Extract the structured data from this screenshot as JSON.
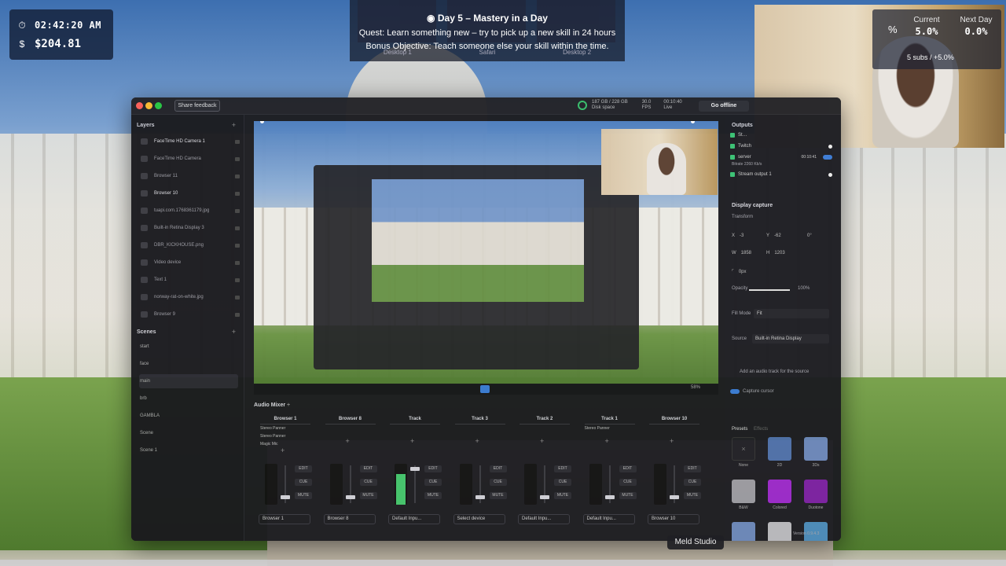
{
  "hud": {
    "time": "02:42:20 AM",
    "money": "$204.81",
    "clock_icon": "clock-icon",
    "dollar_sign": "$"
  },
  "quest": {
    "title": "Day 5 – Mastery in a Day",
    "quest_line": "Quest: Learn something new – try to pick up a new skill in 24 hours",
    "bonus_line": "Bonus Objective: Teach someone else your skill within the time.",
    "desktop_labels": [
      "Desktop 1",
      "Safari",
      "Desktop 2"
    ]
  },
  "rate": {
    "icon": "%",
    "current_label": "Current",
    "current_value": "5.0%",
    "next_label": "Next Day",
    "next_value": "0.0%",
    "subs_text": "5 subs / +5.0%"
  },
  "app": {
    "share_feedback": "Share feedback",
    "disk_space_value": "187 GB / 228 GB",
    "disk_space_label": "Disk space",
    "fps_value": "30.0",
    "fps_label": "FPS",
    "live_time": "00:10:40",
    "live_label": "Live",
    "go_offline": "Go offline"
  },
  "layers": {
    "header": "Layers",
    "items": [
      "FaceTime HD Camera 1",
      "FaceTime HD Camera",
      "Browser 11",
      "Browser 10",
      "tuapi.com.1768361179.jpg",
      "Built-in Retina Display 3",
      "DBR_KICKHOUSE.png",
      "Video device",
      "Text 1",
      "norway-rat-on-white.jpg",
      "Browser 9"
    ]
  },
  "scenes": {
    "header": "Scenes",
    "items": [
      "start",
      "face",
      "main",
      "brb",
      "GAMBLA",
      "Scene",
      "Scene 1"
    ],
    "selected": "main"
  },
  "outputs": {
    "header": "Outputs",
    "items": [
      {
        "name": "Twitch"
      },
      {
        "name": "server",
        "status": "00:10:41",
        "bitrate": "Bitrate 2260 Kb/s"
      },
      {
        "name": "Stream output 1"
      }
    ]
  },
  "display_capture": {
    "header": "Display capture",
    "transform_label": "Transform",
    "x_label": "X",
    "x_value": "-3",
    "y_label": "Y",
    "y_value": "-62",
    "rotation_value": "0°",
    "w_label": "W",
    "w_value": "1858",
    "h_label": "H",
    "h_value": "1203",
    "corner_value": "0px",
    "opacity_label": "Opacity",
    "opacity_value": "100%",
    "opacity_level": 1.0,
    "fill_mode_label": "Fill Mode",
    "fill_mode_value": "Fit",
    "source_label": "Source",
    "source_value": "Built-in Retina Display",
    "audio_track_label": "Add an audio track for the source",
    "capture_cursor_label": "Capture cursor"
  },
  "presets": {
    "tabs": [
      "Presets",
      "Effects"
    ],
    "items": [
      "None",
      "2D",
      "3Ds",
      "B&W",
      "Colored",
      "Duotone",
      "",
      "",
      ""
    ],
    "version": "Version 0.9.4.3"
  },
  "mixer": {
    "header": "Audio Mixer",
    "channels": [
      {
        "name": "Browser 1",
        "filters": [
          "Stereo Panner",
          "Stereo Panner",
          "Magic Mic"
        ],
        "source": "Browser 1",
        "level": 0.0
      },
      {
        "name": "Browser 8",
        "filters": [],
        "source": "Browser 8",
        "level": 0.0
      },
      {
        "name": "Track",
        "filters": [],
        "source": "Default Inpu...",
        "level": 0.75
      },
      {
        "name": "Track 3",
        "filters": [],
        "source": "Select device",
        "level": 0.0
      },
      {
        "name": "Track 2",
        "filters": [],
        "source": "Default Inpu...",
        "level": 0.0
      },
      {
        "name": "Track 1",
        "filters": [
          "Stereo Panner"
        ],
        "source": "Default Inpu...",
        "level": 0.0
      },
      {
        "name": "Browser 10",
        "filters": [],
        "source": "Browser 10",
        "level": 0.0
      }
    ],
    "buttons": {
      "edit": "EDIT",
      "cue": "CUE",
      "mute": "MUTE"
    }
  },
  "preview": {
    "zoom": "58%"
  },
  "tooltip": {
    "text": "Meld Studio"
  },
  "colors": {
    "live_green": "#39c06b",
    "accent_blue": "#3a7bd5",
    "meter_green": "#42c46a"
  }
}
